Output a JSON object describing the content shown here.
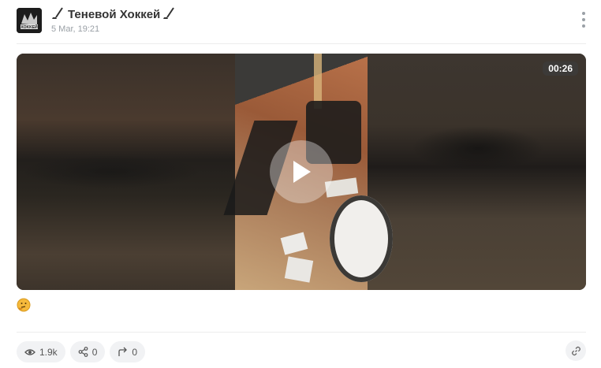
{
  "post": {
    "channel_name": "Теневой Хоккей",
    "date": "5 Mar, 19:21",
    "avatar_text": "XOKKEЙ"
  },
  "video": {
    "duration": "00:26"
  },
  "reactions": {
    "emoji": "🤔"
  },
  "stats": {
    "views": "1.9k",
    "shares": "0",
    "forwards": "0"
  },
  "icons": {
    "menu": "kebab-menu-icon",
    "play": "play-icon",
    "views": "eye-icon",
    "shares": "share-icon",
    "forwards": "forward-icon",
    "link": "link-icon"
  }
}
